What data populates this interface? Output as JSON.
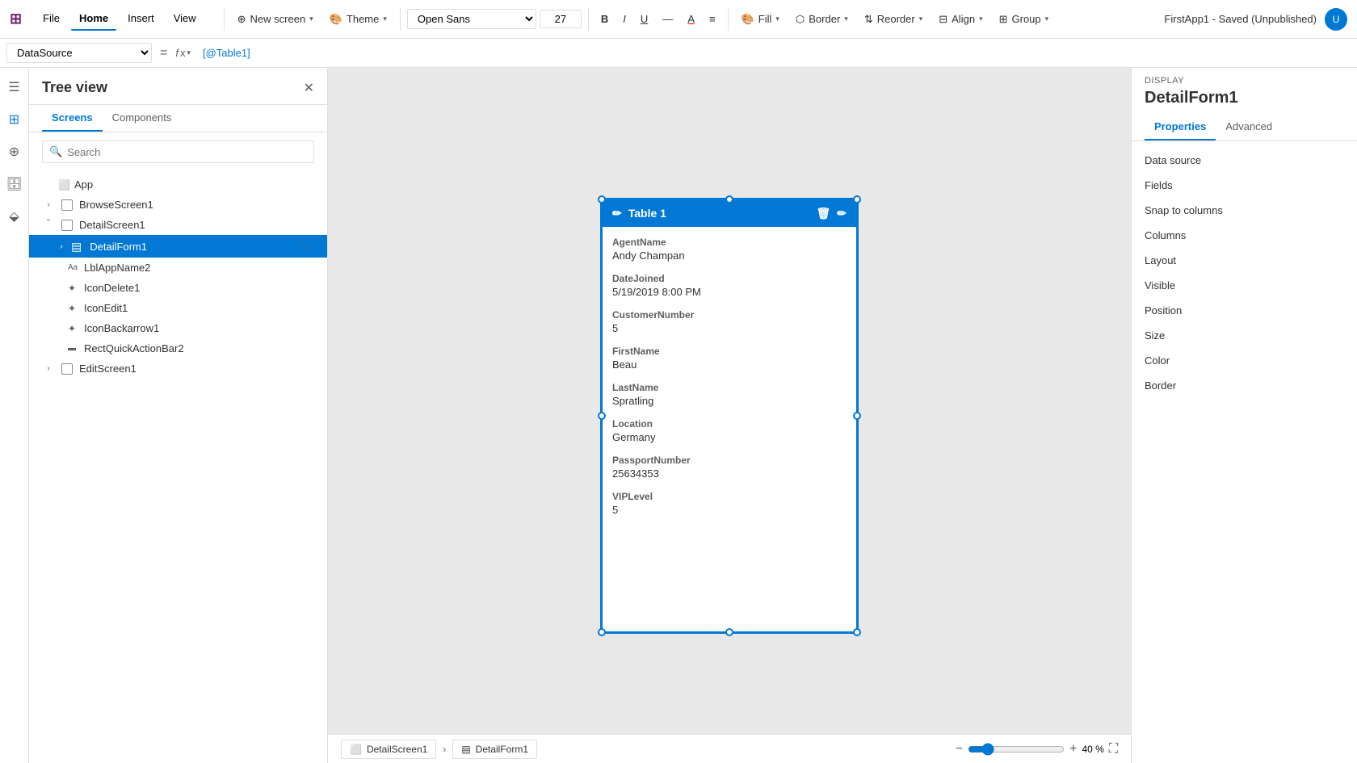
{
  "app": {
    "title": "FirstApp1 - Saved (Unpublished)"
  },
  "topbar": {
    "logo": "⊞",
    "nav": [
      {
        "label": "File",
        "active": false
      },
      {
        "label": "Home",
        "active": true
      },
      {
        "label": "Insert",
        "active": false
      },
      {
        "label": "View",
        "active": false
      }
    ],
    "new_screen_label": "New screen",
    "theme_label": "Theme",
    "font_value": "Open Sans",
    "font_size": "27",
    "bold_label": "B",
    "italic_label": "I",
    "underline_label": "U",
    "strikethrough_label": "—",
    "fontcolor_label": "A",
    "align_label": "≡",
    "fill_label": "Fill",
    "border_label": "Border",
    "reorder_label": "Reorder",
    "align2_label": "Align",
    "group_label": "Group"
  },
  "formulabar": {
    "datasource_label": "DataSource",
    "formula_value": "[@Table1]"
  },
  "treeview": {
    "title": "Tree view",
    "tabs": [
      {
        "label": "Screens",
        "active": true
      },
      {
        "label": "Components",
        "active": false
      }
    ],
    "search_placeholder": "Search",
    "items": [
      {
        "label": "App",
        "indent": 0,
        "type": "app",
        "expandable": false
      },
      {
        "label": "BrowseScreen1",
        "indent": 0,
        "type": "screen",
        "expandable": true
      },
      {
        "label": "DetailScreen1",
        "indent": 0,
        "type": "screen",
        "expandable": true,
        "expanded": true
      },
      {
        "label": "DetailForm1",
        "indent": 1,
        "type": "form",
        "expandable": true,
        "selected": true
      },
      {
        "label": "LblAppName2",
        "indent": 2,
        "type": "label"
      },
      {
        "label": "IconDelete1",
        "indent": 2,
        "type": "icon"
      },
      {
        "label": "IconEdit1",
        "indent": 2,
        "type": "icon"
      },
      {
        "label": "IconBackarrow1",
        "indent": 2,
        "type": "icon"
      },
      {
        "label": "RectQuickActionBar2",
        "indent": 2,
        "type": "rect"
      },
      {
        "label": "EditScreen1",
        "indent": 0,
        "type": "screen",
        "expandable": true
      }
    ]
  },
  "canvas": {
    "table_title": "Table 1",
    "form_fields": [
      {
        "label": "AgentName",
        "value": "Andy Champan"
      },
      {
        "label": "DateJoined",
        "value": "5/19/2019 8:00 PM"
      },
      {
        "label": "CustomerNumber",
        "value": "5"
      },
      {
        "label": "FirstName",
        "value": "Beau"
      },
      {
        "label": "LastName",
        "value": "Spratling"
      },
      {
        "label": "Location",
        "value": "Germany"
      },
      {
        "label": "PassportNumber",
        "value": "25634353"
      },
      {
        "label": "VIPLevel",
        "value": "5"
      }
    ]
  },
  "right_panel": {
    "display_label": "DISPLAY",
    "section_title": "DetailForm1",
    "tabs": [
      {
        "label": "Properties",
        "active": true
      },
      {
        "label": "Advanced",
        "active": false
      }
    ],
    "properties": [
      {
        "name": "Data source",
        "value": ""
      },
      {
        "name": "Fields",
        "value": ""
      },
      {
        "name": "Snap to columns",
        "value": ""
      },
      {
        "name": "Columns",
        "value": ""
      },
      {
        "name": "Layout",
        "value": ""
      },
      {
        "name": "Visible",
        "value": ""
      },
      {
        "name": "Position",
        "value": ""
      },
      {
        "name": "Size",
        "value": ""
      },
      {
        "name": "Color",
        "value": ""
      },
      {
        "name": "Border",
        "value": ""
      }
    ]
  },
  "statusbar": {
    "tabs": [
      {
        "label": "DetailScreen1"
      },
      {
        "label": "DetailForm1"
      }
    ],
    "zoom_value": "40 %",
    "zoom_percent": 40
  },
  "icons": {
    "menu": "☰",
    "close": "✕",
    "search": "🔍",
    "expand_right": "›",
    "expand_down": "∨",
    "app": "⬜",
    "screen": "☐",
    "form": "▤",
    "label_icon": "Aa",
    "icon_type": "✦",
    "rect_icon": "▬",
    "pencil": "✏",
    "trash": "🗑",
    "zoom_in": "+",
    "zoom_out": "−",
    "expand": "⛶",
    "dropdown_caret": "▾",
    "paint": "🎨",
    "border_icon": "⬡",
    "reorder_icon": "⇅",
    "align_icon": "⊟",
    "group_icon": "⊞"
  }
}
